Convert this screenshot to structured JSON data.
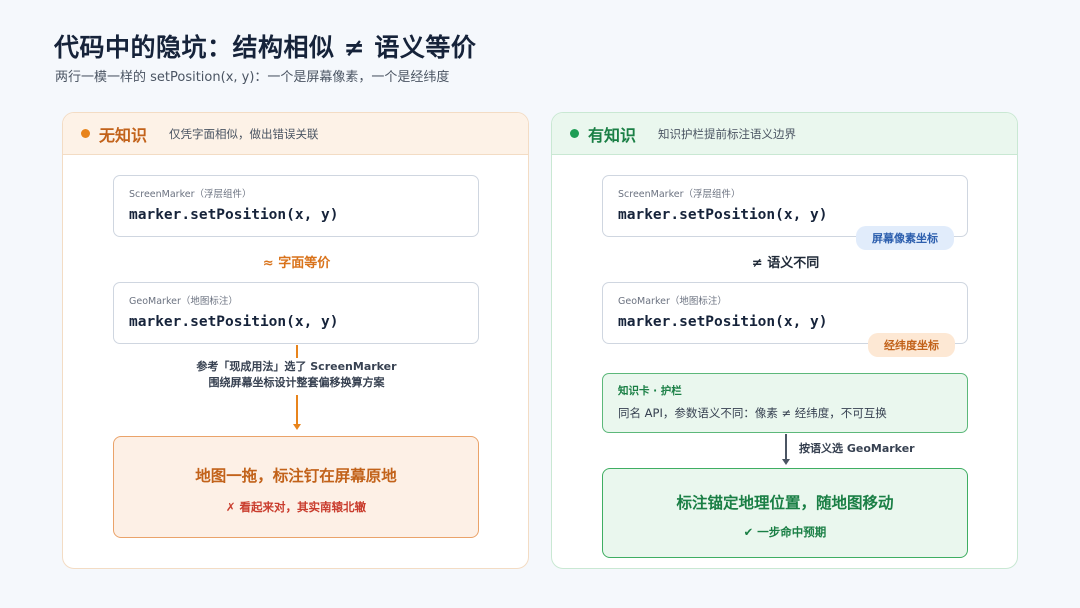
{
  "header": {
    "title": "代码中的隐坑：结构相似 ≠ 语义等价",
    "subtitle": "两行一模一样的 setPosition(x, y)：一个是屏幕像素，一个是经纬度"
  },
  "left": {
    "title": "无知识",
    "desc": "仅凭字面相似，做出错误关联",
    "card1": {
      "label": "ScreenMarker（浮层组件）",
      "code": "marker.setPosition(x, y)"
    },
    "relation": "≈ 字面等价",
    "card2": {
      "label": "GeoMarker（地图标注）",
      "code": "marker.setPosition(x, y)"
    },
    "note_line1": "参考「现成用法」选了 ScreenMarker",
    "note_line2": "围绕屏幕坐标设计整套偏移换算方案",
    "result": {
      "main": "地图一拖，标注钉在屏幕原地",
      "sub": "✗ 看起来对，其实南辕北辙"
    }
  },
  "right": {
    "title": "有知识",
    "desc": "知识护栏提前标注语义边界",
    "card1": {
      "label": "ScreenMarker（浮层组件）",
      "code": "marker.setPosition(x, y)",
      "tag": "屏幕像素坐标"
    },
    "relation": "≠ 语义不同",
    "card2": {
      "label": "GeoMarker（地图标注）",
      "code": "marker.setPosition(x, y)",
      "tag": "经纬度坐标"
    },
    "knowledge": {
      "title": "知识卡 · 护栏",
      "text": "同名 API，参数语义不同：像素 ≠ 经纬度，不可互换"
    },
    "note": "按语义选 GeoMarker",
    "result": {
      "main": "标注锚定地理位置，随地图移动",
      "sub": "✔ 一步命中预期"
    }
  },
  "colors": {
    "left_accent": "#e8841c",
    "right_accent": "#1f9d55",
    "error": "#c93c2d"
  }
}
